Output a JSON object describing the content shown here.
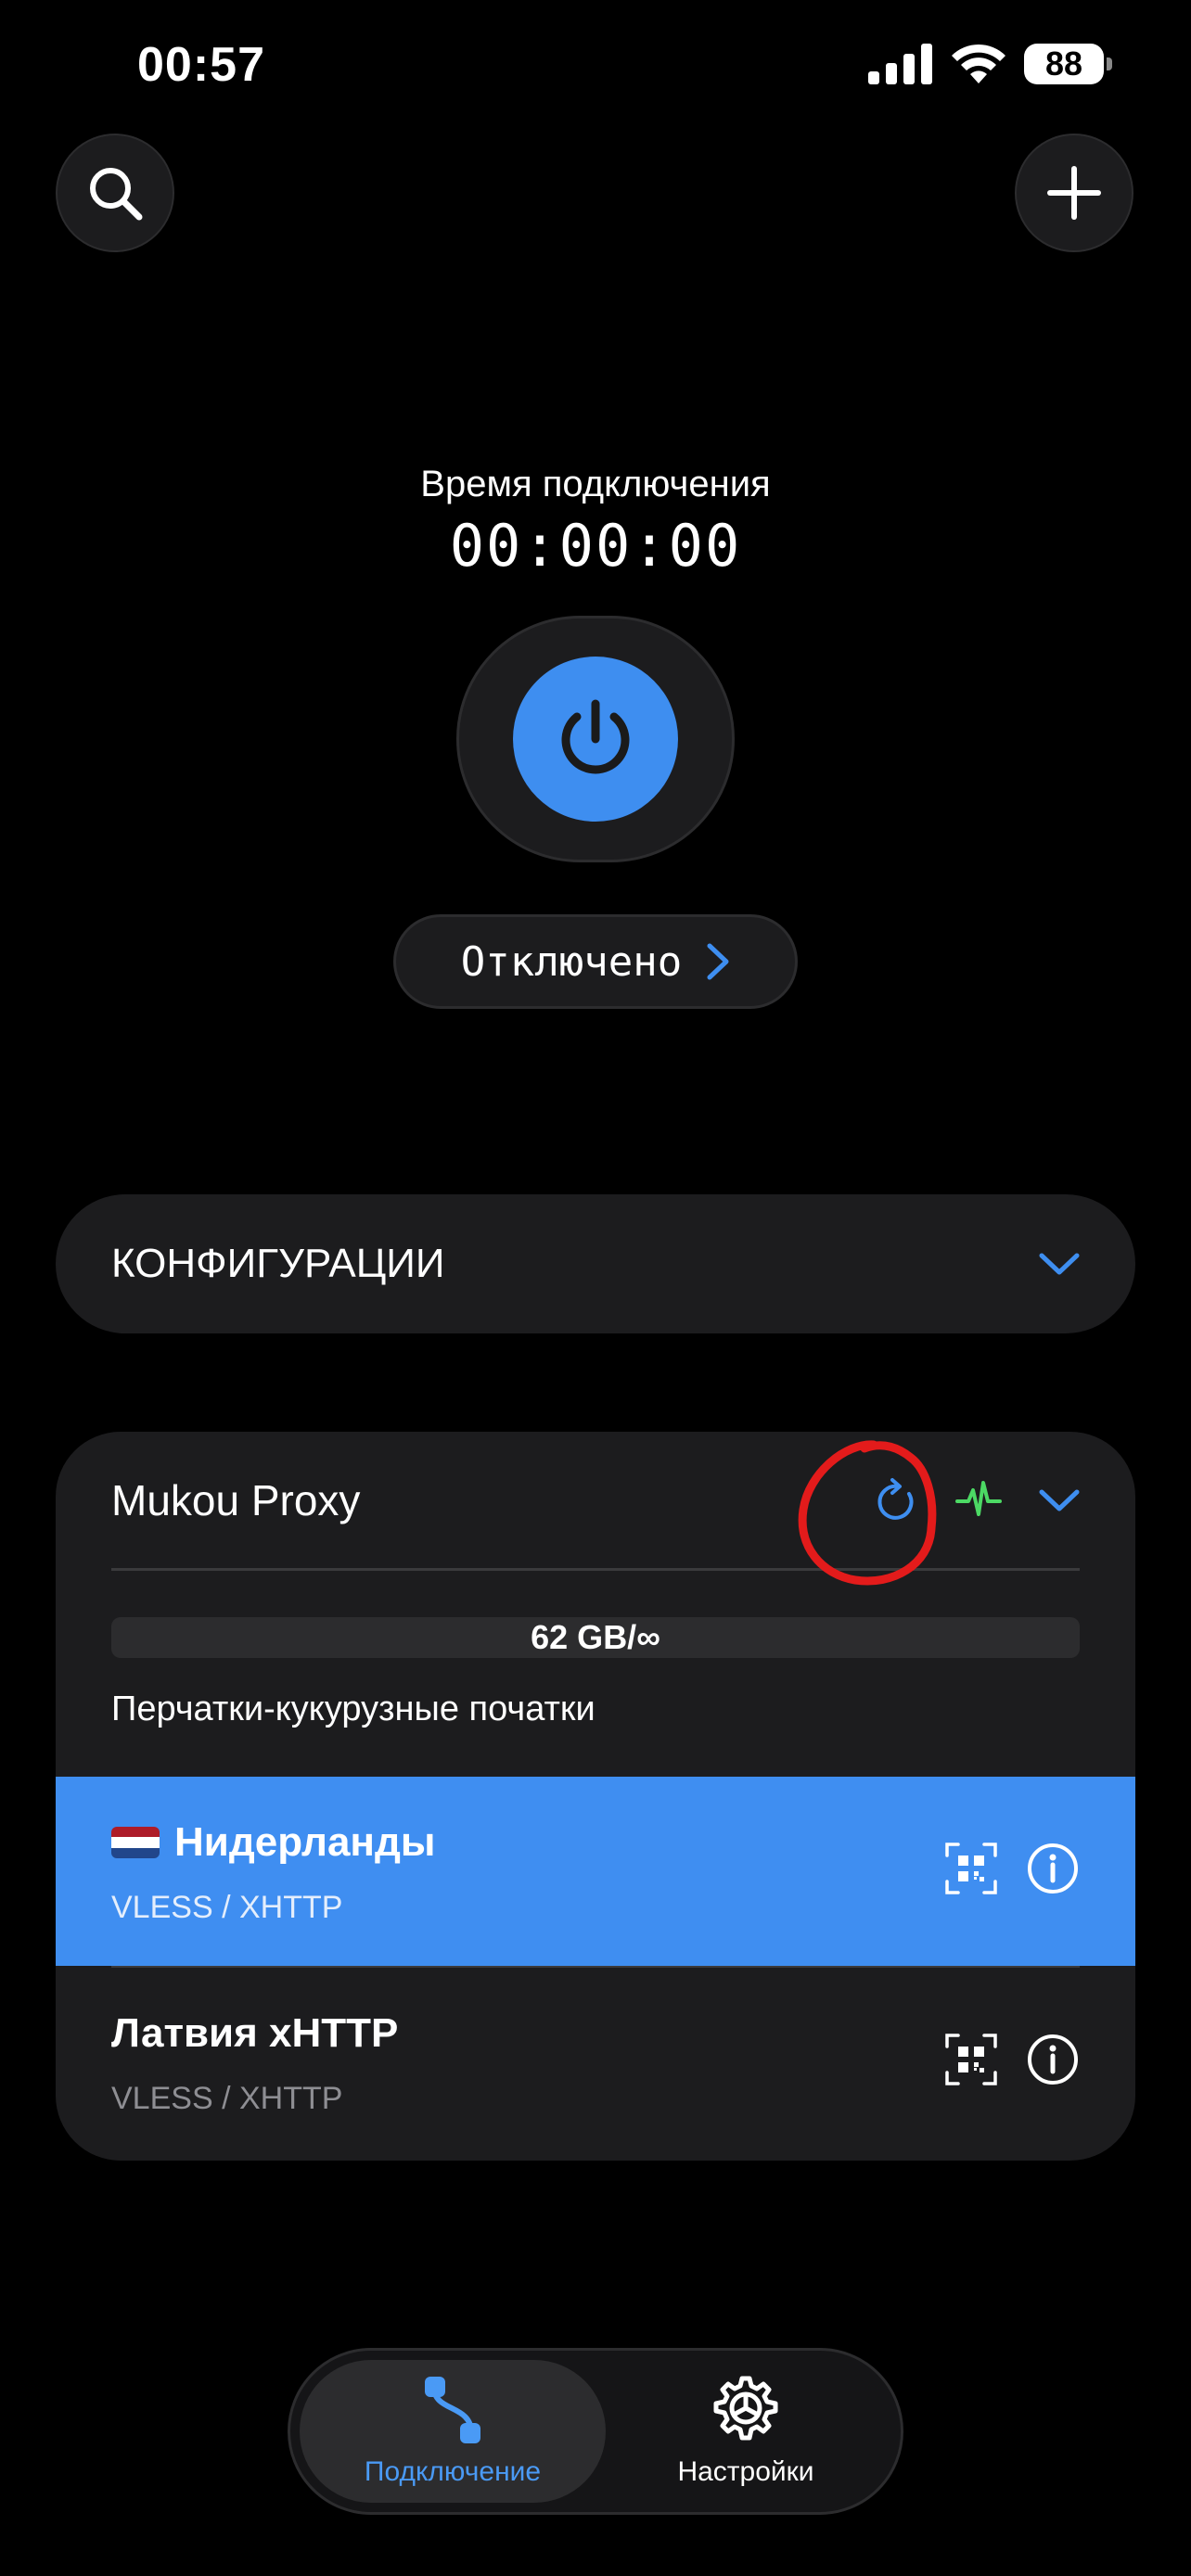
{
  "status_bar": {
    "time": "00:57",
    "battery": "88",
    "icons": [
      "signal-icon",
      "wifi-icon",
      "battery-icon"
    ]
  },
  "top_bar": {
    "left_icon": "search-icon",
    "right_icon": "plus-icon"
  },
  "connection": {
    "time_label": "Время подключения",
    "time_value": "00:00:00",
    "status": "Отключено"
  },
  "configurations": {
    "header": "КОНФИГУРАЦИИ"
  },
  "group": {
    "title": "Mukou Proxy",
    "usage": "62 GB/∞",
    "subtitle": "Перчатки-кукурузные початки",
    "servers": [
      {
        "name": "Нидерланды",
        "protocol": "VLESS / XHTTP",
        "selected": true,
        "flag": "netherlands-flag-icon"
      },
      {
        "name": "Латвия xHTTP",
        "protocol": "VLESS / XHTTP",
        "selected": false
      }
    ]
  },
  "tabbar": {
    "tabs": [
      {
        "label": "Подключение",
        "icon": "connection-icon",
        "active": true
      },
      {
        "label": "Настройки",
        "icon": "gear-icon",
        "active": false
      }
    ]
  },
  "colors": {
    "accent": "#3e8ef0",
    "card": "#1c1c1e",
    "background": "#000000",
    "ping_green": "#4cd964",
    "annotation_red": "#e31b1b"
  }
}
